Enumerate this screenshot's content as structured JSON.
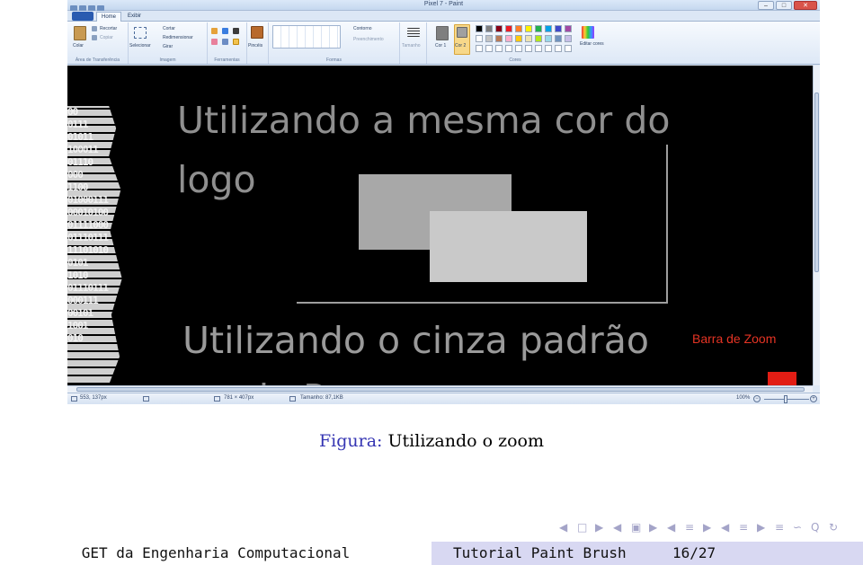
{
  "paint": {
    "window_title": "Pixel 7 - Paint",
    "window_buttons": {
      "minimize": "–",
      "maximize": "□",
      "close": "✕"
    },
    "tabs": [
      {
        "label": "Home"
      },
      {
        "label": "Exibir"
      }
    ],
    "ribbon": {
      "clipboard": {
        "paste": "Colar",
        "cut": "Recortar",
        "copy": "Copiar",
        "group_label": "Área de Transferência"
      },
      "image": {
        "select": "Selecionar",
        "crop": "Cortar",
        "resize": "Redimensionar",
        "rotate": "Girar",
        "group_label": "Imagem"
      },
      "tools": {
        "group_label": "Ferramentas"
      },
      "brushes": {
        "label": "Pincéis"
      },
      "shapes": {
        "outline": "Contorno",
        "fill": "Preenchimento",
        "group_label": "Formas"
      },
      "size": {
        "label": "Tamanho"
      },
      "color1": {
        "label": "Cor 1"
      },
      "color2": {
        "label": "Cor 2"
      },
      "edit_colors": {
        "label": "Editar cores"
      },
      "colors": {
        "group_label": "Cores",
        "palette_row1": [
          "#000000",
          "#7f7f7f",
          "#880015",
          "#ed1c24",
          "#ff7f27",
          "#fff200",
          "#22b14c",
          "#00a2e8",
          "#3f48cc",
          "#a349a4"
        ],
        "palette_row2": [
          "#ffffff",
          "#c3c3c3",
          "#b97a57",
          "#ffaec9",
          "#ffc90e",
          "#efe4b0",
          "#b5e61d",
          "#99d9ea",
          "#7092be",
          "#c8bfe7"
        ],
        "palette_row3": [
          "#ffffff",
          "#ffffff",
          "#ffffff",
          "#ffffff",
          "#ffffff",
          "#ffffff",
          "#ffffff",
          "#ffffff",
          "#ffffff",
          "#ffffff"
        ]
      }
    },
    "canvas": {
      "heading1": "Utilizando a mesma cor do logo",
      "heading2": "Utilizando o cinza padrão",
      "heading2_cut": "do P",
      "binary_lines": [
        "00",
        "0111",
        "01011",
        "100011",
        "01110",
        "000",
        "1100",
        "01000111",
        "00010100",
        "01111000",
        "01110111",
        "11101010",
        "0101",
        "1010",
        "01110111",
        "000111",
        "00101",
        "1001",
        "010"
      ],
      "zoom_annotation": "Barra de Zoom"
    },
    "statusbar": {
      "cursor_pos": "553, 137px",
      "selection_size": "781 × 407px",
      "file_size": "Tamanho: 87,1KB",
      "zoom": "100%",
      "zoom_out": "−",
      "zoom_in": "+"
    },
    "colors": {
      "accent_red": "#e53424",
      "canvas_bg": "#000000",
      "rect_dark": "#a8a8a8",
      "rect_light": "#c9c9c9"
    }
  },
  "slide": {
    "caption_label": "Figura:",
    "caption_text": "Utilizando o zoom",
    "footer_left": "GET da Engenharia Computacional",
    "footer_title": "Tutorial Paint Brush",
    "footer_page": "16/27",
    "nav_symbols": [
      "◀",
      "□",
      "▶",
      "◀",
      "▣",
      "▶",
      "◀",
      "≡",
      "▶",
      "◀",
      "≡",
      "▶",
      "≡",
      "∽",
      "Q",
      "↻"
    ]
  }
}
